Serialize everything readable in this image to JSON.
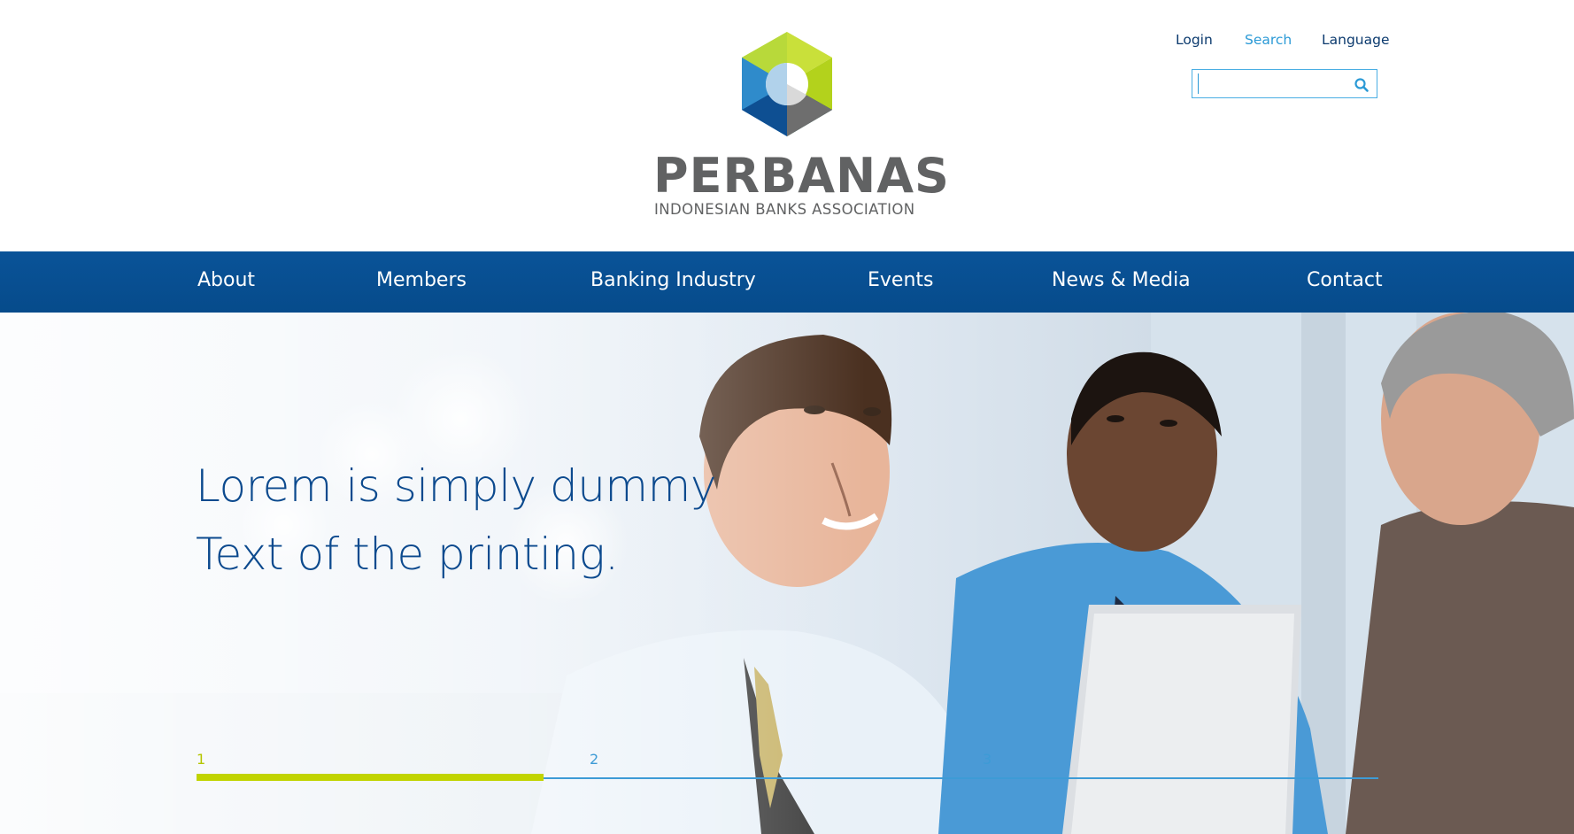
{
  "header": {
    "logo": {
      "name": "PERBANAS",
      "tagline": "INDONESIAN BANKS ASSOCIATION"
    },
    "utility_links": {
      "login": "Login",
      "search": "Search",
      "language": "Language"
    },
    "search": {
      "value": "",
      "icon": "search-icon"
    }
  },
  "nav": {
    "items": [
      {
        "label": "About"
      },
      {
        "label": "Members"
      },
      {
        "label": "Banking Industry"
      },
      {
        "label": "Events"
      },
      {
        "label": "News & Media"
      },
      {
        "label": "Contact"
      }
    ]
  },
  "hero": {
    "headline_line1": "Lorem is simply dummy",
    "headline_line2": "Text of the printing.",
    "slider": {
      "slides": [
        "1",
        "2",
        "3"
      ],
      "active_index": 0,
      "progress_fraction": 0.294
    }
  },
  "colors": {
    "nav_bg": "#0a5398",
    "headline": "#0c4a8e",
    "accent_green": "#c1d400",
    "accent_blue": "#3d9bd6",
    "logo_gray": "#616263"
  }
}
